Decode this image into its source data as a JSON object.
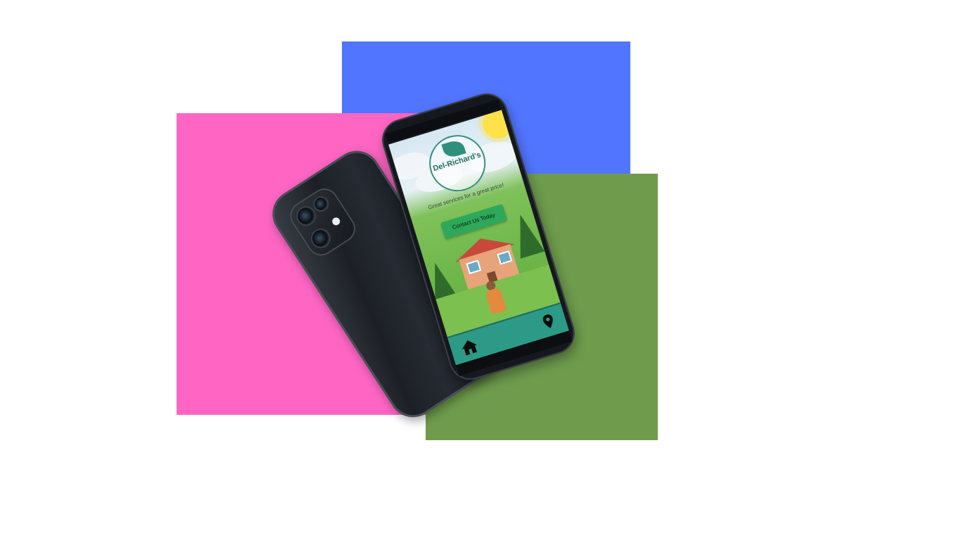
{
  "colors": {
    "background": "#ffffff",
    "blue_block": "#5275ff",
    "pink_block": "#ff66c4",
    "green_block": "#6e9c4c",
    "nav_bar": "#2c9a86",
    "button": "#2ea85a"
  },
  "app": {
    "brand": "Del-Richard's",
    "tagline": "Great services for a great price!",
    "cta_button": "Contact Us Today"
  },
  "nav": {
    "home_icon": "home-icon",
    "location_icon": "location-pin-icon"
  }
}
